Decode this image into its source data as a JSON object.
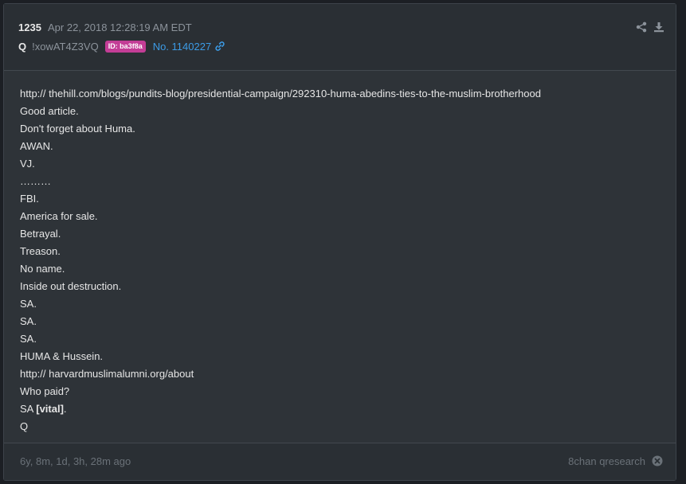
{
  "post": {
    "number": "1235",
    "date": "Apr 22, 2018 12:28:19 AM EDT",
    "author": "Q",
    "tripcode": "!xowAT4Z3VQ",
    "id_badge": "ID: ba3f8a",
    "post_no": "No. 1140227"
  },
  "body": {
    "lines": [
      "http:// thehill.com/blogs/pundits-blog/presidential-campaign/292310-huma-abedins-ties-to-the-muslim-brotherhood",
      "Good article.",
      "Don't forget about Huma.",
      "AWAN.",
      "VJ.",
      "………",
      "FBI.",
      "America for sale.",
      "Betrayal.",
      "Treason.",
      "No name.",
      "Inside out destruction.",
      "SA.",
      "SA.",
      "SA.",
      "HUMA & Hussein.",
      "http:// harvardmuslimalumni.org/about",
      "Who paid?"
    ],
    "vital_prefix": "SA ",
    "vital_text": "[vital]",
    "vital_suffix": ".",
    "signoff": "Q"
  },
  "footer": {
    "ago": "6y, 8m, 1d, 3h, 28m ago",
    "source": "8chan qresearch"
  },
  "colors": {
    "accent_link": "#3c9be6",
    "id_badge_bg": "#c33d96",
    "card_bg": "#2e3338"
  },
  "icons": [
    "link-icon",
    "share-icon",
    "download-icon",
    "close-icon"
  ]
}
